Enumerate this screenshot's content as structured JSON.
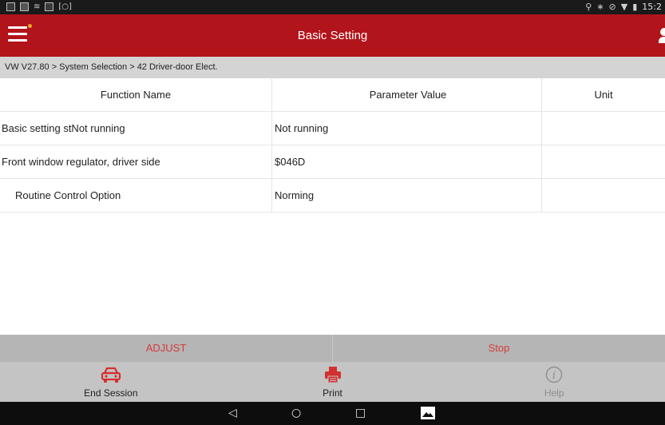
{
  "status_bar": {
    "time": "15:2",
    "left_icons": [
      "notification-icon",
      "message-icon",
      "wifi-icon",
      "notification-icon",
      "screenshot-icon"
    ],
    "right_icons": [
      "location-icon",
      "bluetooth-icon",
      "blocked-icon",
      "wifi-icon",
      "battery-icon"
    ]
  },
  "header": {
    "title": "Basic Setting",
    "accent_color": "#b2141b",
    "notification_dot_color": "#f6a623"
  },
  "breadcrumb": "VW V27.80 > System Selection > 42 Driver-door Elect.",
  "table": {
    "columns": [
      "Function Name",
      "Parameter Value",
      "Unit"
    ],
    "rows": [
      {
        "name": "Basic setting stNot running",
        "value": "Not running",
        "unit": ""
      },
      {
        "name": "Front window regulator, driver side",
        "value": "$046D",
        "unit": ""
      },
      {
        "name": "Routine Control Option",
        "value": "Norming",
        "unit": ""
      }
    ]
  },
  "actions": {
    "adjust": "ADJUST",
    "stop": "Stop",
    "text_color": "#d43c3c"
  },
  "bottom_bar": {
    "end_session": "End Session",
    "print": "Print",
    "help": "Help"
  },
  "nav_bar": {
    "back": "◁",
    "home": "○",
    "recents": "□"
  }
}
